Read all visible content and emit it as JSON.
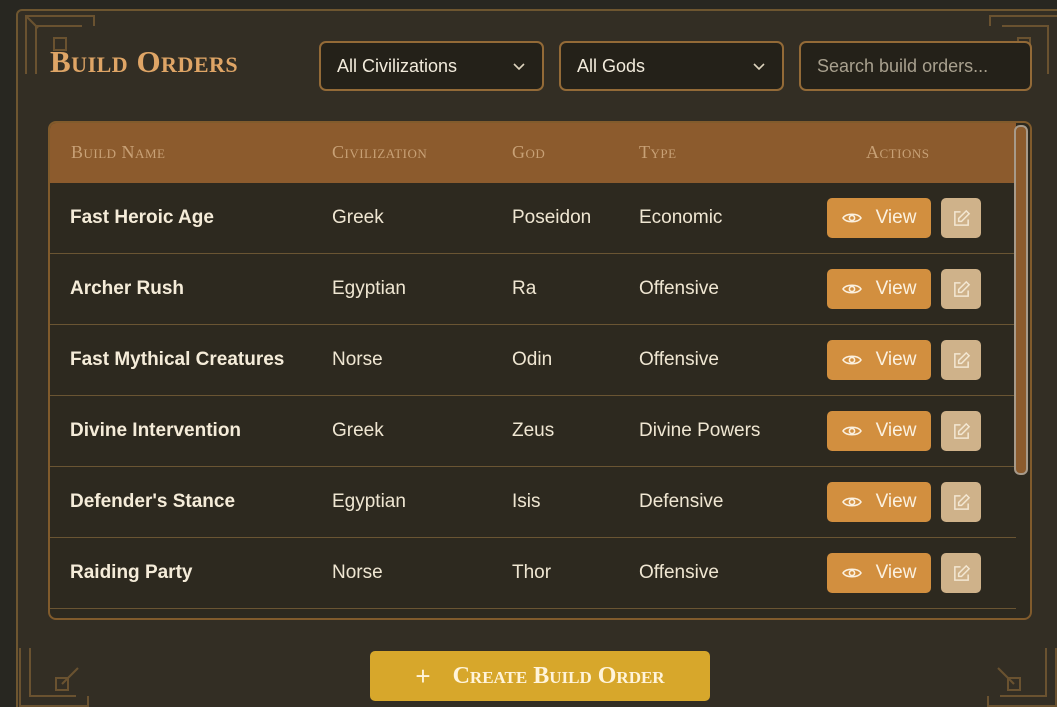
{
  "page": {
    "title": "Build Orders"
  },
  "filters": {
    "civilization": {
      "selected": "All Civilizations"
    },
    "god": {
      "selected": "All Gods"
    },
    "search": {
      "placeholder": "Search build orders..."
    }
  },
  "table": {
    "headers": {
      "name": "Build Name",
      "civilization": "Civilization",
      "god": "God",
      "type": "Type",
      "actions": "Actions"
    },
    "view_label": "View",
    "rows": [
      {
        "name": "Fast Heroic Age",
        "civilization": "Greek",
        "god": "Poseidon",
        "type": "Economic"
      },
      {
        "name": "Archer Rush",
        "civilization": "Egyptian",
        "god": "Ra",
        "type": "Offensive"
      },
      {
        "name": "Fast Mythical Creatures",
        "civilization": "Norse",
        "god": "Odin",
        "type": "Offensive"
      },
      {
        "name": "Divine Intervention",
        "civilization": "Greek",
        "god": "Zeus",
        "type": "Divine Powers"
      },
      {
        "name": "Defender's Stance",
        "civilization": "Egyptian",
        "god": "Isis",
        "type": "Defensive"
      },
      {
        "name": "Raiding Party",
        "civilization": "Norse",
        "god": "Thor",
        "type": "Offensive"
      }
    ]
  },
  "actions": {
    "create_label": "Create Build Order",
    "create_icon": "+"
  },
  "colors": {
    "accent": "#d28f3f",
    "header": "#8c5b2d",
    "create": "#d7a72b",
    "title": "#dfa566"
  }
}
